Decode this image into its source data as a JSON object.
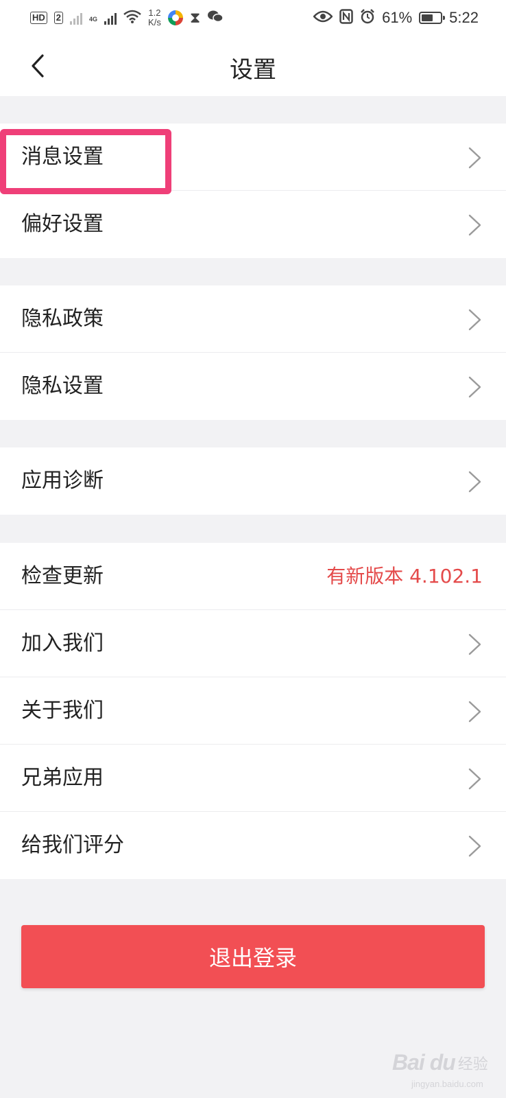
{
  "status_bar": {
    "hd_label": "HD",
    "sim2_label": "2",
    "network_label": "4G",
    "net_speed_value": "1.2",
    "net_speed_unit": "K/s",
    "battery_percent": "61%",
    "battery_level": 0.61,
    "time": "5:22"
  },
  "header": {
    "title": "设置"
  },
  "groups": [
    {
      "items": [
        {
          "label": "消息设置"
        },
        {
          "label": "偏好设置"
        }
      ]
    },
    {
      "items": [
        {
          "label": "隐私政策"
        },
        {
          "label": "隐私设置"
        }
      ]
    },
    {
      "items": [
        {
          "label": "应用诊断"
        }
      ]
    },
    {
      "items": [
        {
          "label": "检查更新",
          "note": "有新版本 4.102.1"
        },
        {
          "label": "加入我们"
        },
        {
          "label": "关于我们"
        },
        {
          "label": "兄弟应用"
        },
        {
          "label": "给我们评分"
        }
      ]
    }
  ],
  "logout_label": "退出登录",
  "watermark": {
    "logo": "Bai du",
    "text": "经验",
    "sub": "jingyan.baidu.com"
  },
  "colors": {
    "accent": "#f24f54",
    "update_note": "#e44a4a",
    "highlight_box": "#ef3f78",
    "background": "#f2f2f4"
  }
}
